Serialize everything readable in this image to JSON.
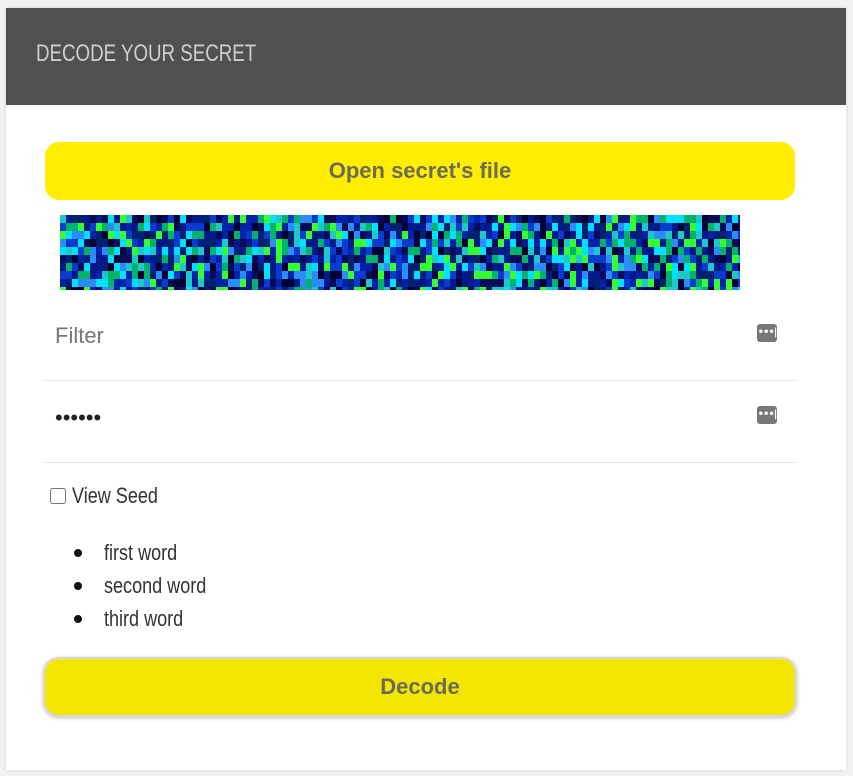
{
  "header": {
    "title": "DECODE YOUR SECRET"
  },
  "open_button": {
    "label": "Open secret's file"
  },
  "secret_image": {
    "alt": ""
  },
  "filter_field": {
    "placeholder": "Filter",
    "value": ""
  },
  "password_field": {
    "value": "••••••"
  },
  "view_seed": {
    "label": "View Seed",
    "checked": false
  },
  "seed_words": [
    "first word",
    "second word",
    "third word"
  ],
  "decode_button": {
    "label": "Decode"
  },
  "colors": {
    "header_bg": "#505050",
    "accent_yellow": "#ffee00",
    "button_text": "#6b6b5a"
  }
}
